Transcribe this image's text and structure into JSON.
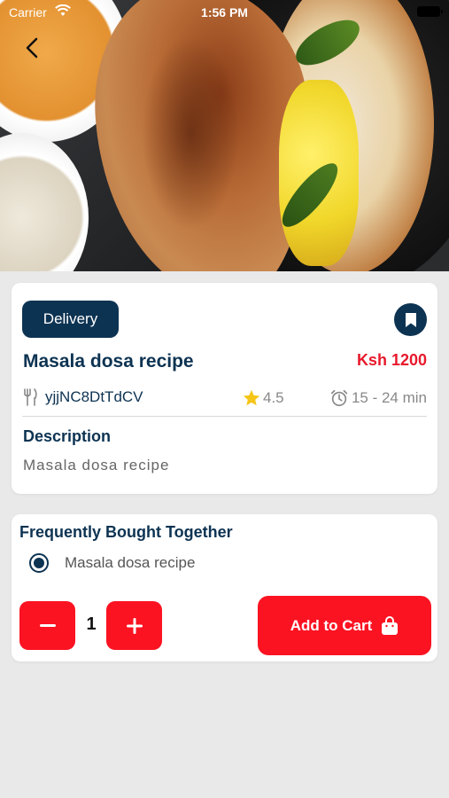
{
  "status_bar": {
    "carrier": "Carrier",
    "time": "1:56 PM"
  },
  "header": {
    "back_icon": "chevron-left-icon"
  },
  "product": {
    "badge": "Delivery",
    "title": "Masala dosa recipe",
    "price": "Ksh 1200",
    "vendor": "yjjNC8DtTdCV",
    "rating": "4.5",
    "duration": "15 - 24 min",
    "description_heading": "Description",
    "description": "Masala dosa recipe"
  },
  "frequently_bought": {
    "heading": "Frequently Bought Together",
    "option_label": "Masala dosa recipe"
  },
  "cart": {
    "quantity": "1",
    "add_label": "Add to Cart"
  },
  "colors": {
    "primary_navy": "#0d3352",
    "accent_red": "#fb1322",
    "price_red": "#e8192c",
    "star_yellow": "#f5c518"
  },
  "icons": [
    "chevron-left-icon",
    "bookmark-icon",
    "fork-knife-icon",
    "star-icon",
    "alarm-clock-icon",
    "minus-icon",
    "plus-icon",
    "shopping-bag-icon",
    "wifi-icon",
    "battery-icon"
  ]
}
